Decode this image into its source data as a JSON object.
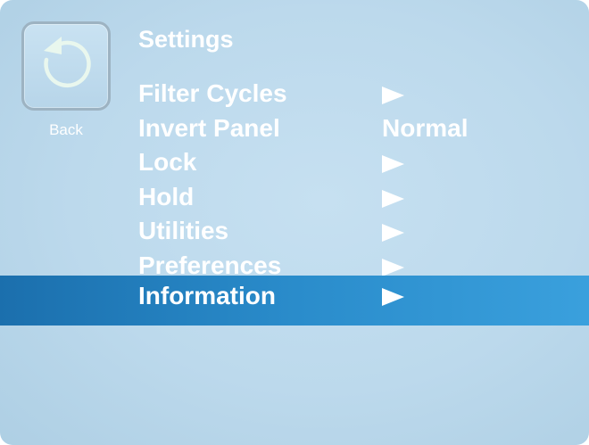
{
  "back": {
    "label": "Back",
    "icon": "circular-back-arrow-icon"
  },
  "title": "Settings",
  "menu": {
    "items": [
      {
        "label": "Filter Cycles",
        "value": "",
        "has_arrow": true,
        "selected": false
      },
      {
        "label": "Invert Panel",
        "value": "Normal",
        "has_arrow": false,
        "selected": false
      },
      {
        "label": "Lock",
        "value": "",
        "has_arrow": true,
        "selected": false
      },
      {
        "label": "Hold",
        "value": "",
        "has_arrow": true,
        "selected": false
      },
      {
        "label": "Utilities",
        "value": "",
        "has_arrow": true,
        "selected": false
      },
      {
        "label": "Preferences",
        "value": "",
        "has_arrow": true,
        "selected": false
      },
      {
        "label": "Information",
        "value": "",
        "has_arrow": true,
        "selected": true
      }
    ]
  },
  "colors": {
    "background": "#bcd9ec",
    "highlight": "#2a8ccb",
    "text": "#ffffff",
    "back_arrow": "#e9f7ee"
  }
}
